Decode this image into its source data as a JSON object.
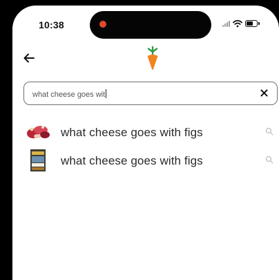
{
  "status_bar": {
    "time": "10:38",
    "icons": [
      "signal-icon",
      "wifi-icon",
      "battery-icon"
    ]
  },
  "header": {
    "back_icon": "arrow-left-icon",
    "logo_icon": "carrot-logo-icon"
  },
  "search": {
    "value": "what cheese goes wit",
    "clear_icon": "close-icon"
  },
  "suggestions": [
    {
      "text": "what cheese goes with figs",
      "thumbnail": "food-thumbnail",
      "icon": "search-icon"
    },
    {
      "text": "what cheese goes with figs",
      "thumbnail": "product-thumbnail",
      "icon": "search-icon"
    }
  ],
  "colors": {
    "accent": "#f0841f",
    "leaf": "#2f9a45",
    "text": "#2b2b2b",
    "field_border": "#6f6f6f"
  }
}
